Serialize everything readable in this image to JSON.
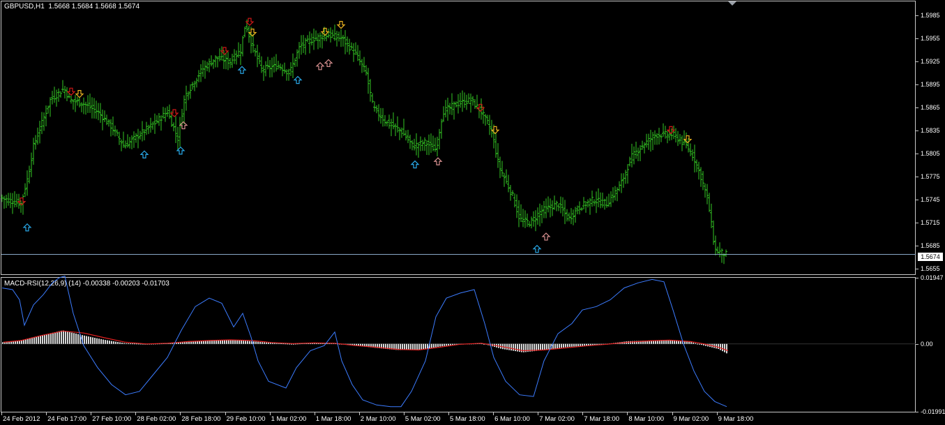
{
  "main": {
    "header": "GBPUSD,H1  1.5668 1.5684 1.5668 1.5674",
    "bid_line": "1.5674",
    "price_axis": [
      "1.5985",
      "1.5955",
      "1.5925",
      "1.5895",
      "1.5865",
      "1.5835",
      "1.5805",
      "1.5775",
      "1.5745",
      "1.5715",
      "1.5685",
      "1.5655"
    ]
  },
  "indicator": {
    "header": "MACD-RSI(12,26,9) (14) -0.00338 -0.00203 -0.01703",
    "axis": [
      "0.01947",
      "0.00",
      "-0.01991"
    ]
  },
  "time_axis": [
    "24 Feb 2012",
    "24 Feb 17:00",
    "27 Feb 10:00",
    "28 Feb 02:00",
    "28 Feb 18:00",
    "29 Feb 10:00",
    "1 Mar 02:00",
    "1 Mar 18:00",
    "2 Mar 10:00",
    "5 Mar 02:00",
    "5 Mar 18:00",
    "6 Mar 10:00",
    "7 Mar 02:00",
    "7 Mar 18:00",
    "8 Mar 10:00",
    "9 Mar 02:00",
    "9 Mar 18:00"
  ],
  "colors": {
    "candle": "#34c924",
    "signal_down_strong": "#d01818",
    "signal_down_weak": "#e8b020",
    "signal_up_strong": "#28a8e8",
    "signal_up_weak": "#d89090",
    "macd_line": "#3c7cff",
    "signal_line": "#e02020",
    "histogram": "#d8d8d8",
    "frame": "#c8c8c8",
    "bid_line": "#8aa8c8"
  },
  "chart_data": {
    "type": "bar",
    "symbol": "GBPUSD",
    "timeframe": "H1",
    "ohlc_last": {
      "open": 1.5668,
      "high": 1.5684,
      "low": 1.5668,
      "close": 1.5674
    },
    "ylim": [
      1.5649,
      1.5998
    ],
    "close_path": [
      [
        0,
        1.5748
      ],
      [
        30,
        1.574
      ],
      [
        40,
        1.5775
      ],
      [
        48,
        1.5815
      ],
      [
        60,
        1.5845
      ],
      [
        72,
        1.5875
      ],
      [
        92,
        1.589
      ],
      [
        100,
        1.5875
      ],
      [
        120,
        1.587
      ],
      [
        140,
        1.586
      ],
      [
        160,
        1.584
      ],
      [
        178,
        1.5815
      ],
      [
        200,
        1.583
      ],
      [
        222,
        1.5845
      ],
      [
        240,
        1.586
      ],
      [
        255,
        1.5825
      ],
      [
        265,
        1.588
      ],
      [
        290,
        1.5915
      ],
      [
        310,
        1.593
      ],
      [
        330,
        1.5925
      ],
      [
        345,
        1.594
      ],
      [
        352,
        1.5975
      ],
      [
        360,
        1.595
      ],
      [
        375,
        1.5915
      ],
      [
        400,
        1.592
      ],
      [
        415,
        1.591
      ],
      [
        430,
        1.5945
      ],
      [
        450,
        1.5955
      ],
      [
        470,
        1.596
      ],
      [
        490,
        1.5955
      ],
      [
        510,
        1.5935
      ],
      [
        525,
        1.591
      ],
      [
        535,
        1.5865
      ],
      [
        555,
        1.5845
      ],
      [
        575,
        1.5835
      ],
      [
        592,
        1.5815
      ],
      [
        610,
        1.582
      ],
      [
        625,
        1.581
      ],
      [
        635,
        1.586
      ],
      [
        655,
        1.587
      ],
      [
        675,
        1.5875
      ],
      [
        690,
        1.586
      ],
      [
        705,
        1.5835
      ],
      [
        715,
        1.579
      ],
      [
        735,
        1.575
      ],
      [
        745,
        1.572
      ],
      [
        760,
        1.5715
      ],
      [
        775,
        1.573
      ],
      [
        800,
        1.574
      ],
      [
        815,
        1.572
      ],
      [
        830,
        1.5735
      ],
      [
        850,
        1.5745
      ],
      [
        870,
        1.574
      ],
      [
        890,
        1.5765
      ],
      [
        905,
        1.58
      ],
      [
        920,
        1.5815
      ],
      [
        940,
        1.583
      ],
      [
        965,
        1.583
      ],
      [
        985,
        1.5815
      ],
      [
        995,
        1.58
      ],
      [
        1005,
        1.5775
      ],
      [
        1015,
        1.5745
      ],
      [
        1025,
        1.568
      ],
      [
        1040,
        1.5674
      ]
    ],
    "signals": [
      {
        "x": 31,
        "price": 1.5742,
        "dir": "down",
        "kind": "strong"
      },
      {
        "x": 39,
        "price": 1.571,
        "dir": "up",
        "kind": "strong"
      },
      {
        "x": 102,
        "price": 1.5885,
        "dir": "down",
        "kind": "strong"
      },
      {
        "x": 114,
        "price": 1.5882,
        "dir": "down",
        "kind": "weak"
      },
      {
        "x": 207,
        "price": 1.5805,
        "dir": "up",
        "kind": "strong"
      },
      {
        "x": 250,
        "price": 1.5857,
        "dir": "down",
        "kind": "strong"
      },
      {
        "x": 263,
        "price": 1.5843,
        "dir": "up",
        "kind": "weak"
      },
      {
        "x": 259,
        "price": 1.581,
        "dir": "up",
        "kind": "strong"
      },
      {
        "x": 322,
        "price": 1.5938,
        "dir": "down",
        "kind": "strong"
      },
      {
        "x": 347,
        "price": 1.5915,
        "dir": "up",
        "kind": "strong"
      },
      {
        "x": 358,
        "price": 1.5976,
        "dir": "down",
        "kind": "strong"
      },
      {
        "x": 362,
        "price": 1.5962,
        "dir": "down",
        "kind": "weak"
      },
      {
        "x": 427,
        "price": 1.5902,
        "dir": "up",
        "kind": "strong"
      },
      {
        "x": 459,
        "price": 1.592,
        "dir": "up",
        "kind": "weak"
      },
      {
        "x": 471,
        "price": 1.5924,
        "dir": "up",
        "kind": "weak"
      },
      {
        "x": 466,
        "price": 1.5963,
        "dir": "down",
        "kind": "weak"
      },
      {
        "x": 489,
        "price": 1.5972,
        "dir": "down",
        "kind": "weak"
      },
      {
        "x": 595,
        "price": 1.5792,
        "dir": "up",
        "kind": "strong"
      },
      {
        "x": 628,
        "price": 1.5796,
        "dir": "up",
        "kind": "weak"
      },
      {
        "x": 689,
        "price": 1.5864,
        "dir": "down",
        "kind": "strong"
      },
      {
        "x": 710,
        "price": 1.5835,
        "dir": "down",
        "kind": "weak"
      },
      {
        "x": 770,
        "price": 1.5682,
        "dir": "up",
        "kind": "strong"
      },
      {
        "x": 783,
        "price": 1.5698,
        "dir": "up",
        "kind": "weak"
      },
      {
        "x": 962,
        "price": 1.5835,
        "dir": "down",
        "kind": "strong"
      },
      {
        "x": 986,
        "price": 1.5823,
        "dir": "down",
        "kind": "weak"
      }
    ],
    "macd_panel": {
      "ylim": [
        -0.02,
        0.0195
      ],
      "rsi_line": [
        [
          3,
          0.0165
        ],
        [
          18,
          0.016
        ],
        [
          28,
          0.013
        ],
        [
          35,
          0.0055
        ],
        [
          48,
          0.0115
        ],
        [
          62,
          0.0145
        ],
        [
          75,
          0.018
        ],
        [
          85,
          0.0195
        ],
        [
          93,
          0.02
        ],
        [
          105,
          0.009
        ],
        [
          120,
          -0.0005
        ],
        [
          140,
          -0.007
        ],
        [
          160,
          -0.012
        ],
        [
          180,
          -0.015
        ],
        [
          200,
          -0.014
        ],
        [
          220,
          -0.009
        ],
        [
          240,
          -0.004
        ],
        [
          260,
          0.004
        ],
        [
          280,
          0.011
        ],
        [
          300,
          0.0135
        ],
        [
          318,
          0.012
        ],
        [
          335,
          0.005
        ],
        [
          348,
          0.009
        ],
        [
          360,
          0.002
        ],
        [
          370,
          -0.005
        ],
        [
          385,
          -0.011
        ],
        [
          410,
          -0.013
        ],
        [
          425,
          -0.007
        ],
        [
          445,
          -0.002
        ],
        [
          465,
          -0.0005
        ],
        [
          480,
          0.0035
        ],
        [
          490,
          -0.005
        ],
        [
          505,
          -0.012
        ],
        [
          520,
          -0.0165
        ],
        [
          540,
          -0.018
        ],
        [
          560,
          -0.0185
        ],
        [
          575,
          -0.0185
        ],
        [
          590,
          -0.014
        ],
        [
          610,
          -0.005
        ],
        [
          625,
          0.008
        ],
        [
          640,
          0.0135
        ],
        [
          660,
          0.015
        ],
        [
          680,
          0.016
        ],
        [
          695,
          0.006
        ],
        [
          708,
          -0.004
        ],
        [
          725,
          -0.011
        ],
        [
          745,
          -0.015
        ],
        [
          765,
          -0.0155
        ],
        [
          780,
          -0.005
        ],
        [
          800,
          0.003
        ],
        [
          820,
          0.006
        ],
        [
          835,
          0.01
        ],
        [
          855,
          0.011
        ],
        [
          875,
          0.013
        ],
        [
          895,
          0.0165
        ],
        [
          915,
          0.018
        ],
        [
          935,
          0.019
        ],
        [
          952,
          0.0183
        ],
        [
          965,
          0.01
        ],
        [
          980,
          0.0
        ],
        [
          995,
          -0.008
        ],
        [
          1010,
          -0.014
        ],
        [
          1025,
          -0.017
        ],
        [
          1042,
          -0.0185
        ]
      ],
      "histogram": [
        [
          5,
          0.0005
        ],
        [
          30,
          0.001
        ],
        [
          60,
          0.0025
        ],
        [
          90,
          0.004
        ],
        [
          120,
          0.0025
        ],
        [
          150,
          0.0012
        ],
        [
          180,
          0.0002
        ],
        [
          210,
          0.0
        ],
        [
          240,
          0.0002
        ],
        [
          270,
          0.0008
        ],
        [
          300,
          0.001
        ],
        [
          330,
          0.0012
        ],
        [
          360,
          0.0008
        ],
        [
          390,
          0.0003
        ],
        [
          420,
          0.0
        ],
        [
          450,
          0.0004
        ],
        [
          480,
          0.0002
        ],
        [
          510,
          -0.0005
        ],
        [
          540,
          -0.0012
        ],
        [
          570,
          -0.0018
        ],
        [
          600,
          -0.0018
        ],
        [
          630,
          -0.0008
        ],
        [
          660,
          0.0
        ],
        [
          690,
          0.0002
        ],
        [
          720,
          -0.0015
        ],
        [
          750,
          -0.0025
        ],
        [
          780,
          -0.0018
        ],
        [
          810,
          -0.001
        ],
        [
          840,
          -0.0005
        ],
        [
          870,
          0.0
        ],
        [
          900,
          0.0008
        ],
        [
          930,
          0.001
        ],
        [
          960,
          0.0012
        ],
        [
          990,
          0.0006
        ],
        [
          1010,
          -0.0005
        ],
        [
          1030,
          -0.0015
        ],
        [
          1044,
          -0.003
        ]
      ],
      "signal_line": [
        [
          5,
          0.0005
        ],
        [
          30,
          0.001
        ],
        [
          60,
          0.0025
        ],
        [
          90,
          0.0038
        ],
        [
          120,
          0.0032
        ],
        [
          150,
          0.0018
        ],
        [
          180,
          0.0005
        ],
        [
          210,
          0.0
        ],
        [
          240,
          0.0002
        ],
        [
          270,
          0.0007
        ],
        [
          300,
          0.001
        ],
        [
          330,
          0.0012
        ],
        [
          360,
          0.001
        ],
        [
          390,
          0.0004
        ],
        [
          420,
          0.0001
        ],
        [
          450,
          0.0003
        ],
        [
          480,
          0.0002
        ],
        [
          510,
          -0.0005
        ],
        [
          540,
          -0.001
        ],
        [
          570,
          -0.0016
        ],
        [
          600,
          -0.0018
        ],
        [
          630,
          -0.001
        ],
        [
          660,
          -0.0001
        ],
        [
          690,
          0.0002
        ],
        [
          720,
          -0.0008
        ],
        [
          750,
          -0.002
        ],
        [
          780,
          -0.0018
        ],
        [
          810,
          -0.0012
        ],
        [
          840,
          -0.0006
        ],
        [
          870,
          -0.0001
        ],
        [
          900,
          0.0005
        ],
        [
          930,
          0.0009
        ],
        [
          960,
          0.0011
        ],
        [
          990,
          0.0007
        ],
        [
          1010,
          0.0
        ],
        [
          1030,
          -0.001
        ],
        [
          1044,
          -0.002
        ]
      ]
    }
  }
}
